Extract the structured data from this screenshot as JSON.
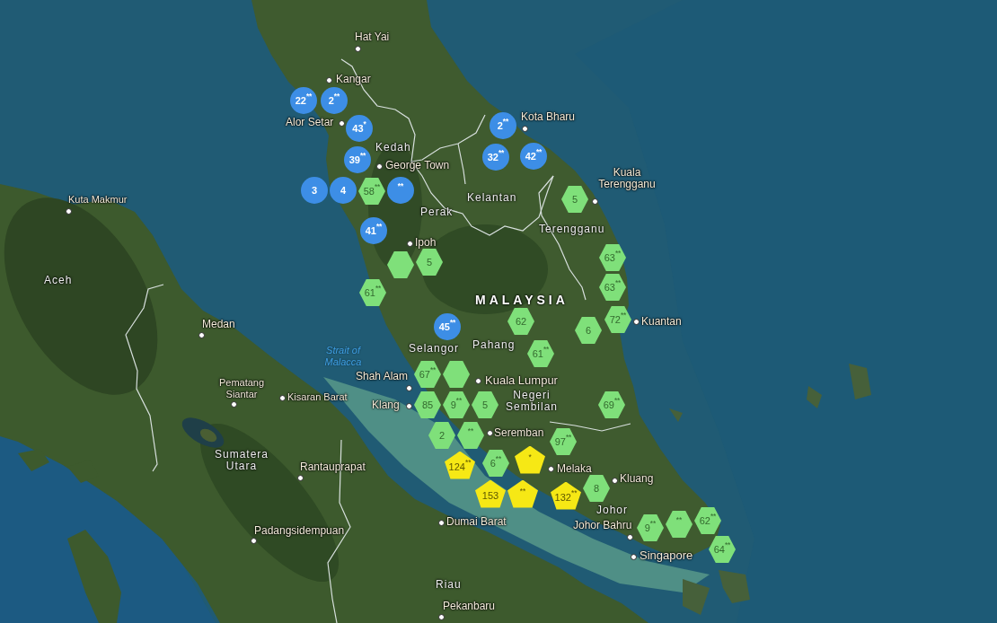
{
  "map": {
    "places": [
      {
        "kind": "city",
        "label": "Hat Yai"
      },
      {
        "kind": "city",
        "label": "Kangar"
      },
      {
        "kind": "city",
        "label": "Alor Setar"
      },
      {
        "kind": "city",
        "label": "Kota Bharu"
      },
      {
        "kind": "region",
        "label": "Kedah"
      },
      {
        "kind": "city",
        "label": "George Town"
      },
      {
        "kind": "city",
        "label": "Kuala Terengganu"
      },
      {
        "kind": "city",
        "label": "Kuta Makmur"
      },
      {
        "kind": "region",
        "label": "Kelantan"
      },
      {
        "kind": "region",
        "label": "Perak"
      },
      {
        "kind": "region",
        "label": "Terengganu"
      },
      {
        "kind": "city",
        "label": "Ipoh"
      },
      {
        "kind": "region",
        "label": "Aceh"
      },
      {
        "kind": "country",
        "label": "MALAYSIA"
      },
      {
        "kind": "city",
        "label": "Medan"
      },
      {
        "kind": "city",
        "label": "Kuantan"
      },
      {
        "kind": "sea",
        "label": "Strait of Malacca"
      },
      {
        "kind": "region",
        "label": "Selangor"
      },
      {
        "kind": "region",
        "label": "Pahang"
      },
      {
        "kind": "city",
        "label": "Shah Alam"
      },
      {
        "kind": "city",
        "label": "Pematang Siantar"
      },
      {
        "kind": "city",
        "label": "Kuala Lumpur"
      },
      {
        "kind": "city",
        "label": "Kisaran Barat"
      },
      {
        "kind": "city",
        "label": "Klang"
      },
      {
        "kind": "region",
        "label": "Negeri Sembilan"
      },
      {
        "kind": "city",
        "label": "Seremban"
      },
      {
        "kind": "region",
        "label": "Sumatera Utara"
      },
      {
        "kind": "city",
        "label": "Rantauprapat"
      },
      {
        "kind": "city",
        "label": "Melaka"
      },
      {
        "kind": "city",
        "label": "Kluang"
      },
      {
        "kind": "region",
        "label": "Johor"
      },
      {
        "kind": "city",
        "label": "Dumai Barat"
      },
      {
        "kind": "city",
        "label": "Padangsidempuan"
      },
      {
        "kind": "city",
        "label": "Johor Bahru"
      },
      {
        "kind": "city",
        "label": "Singapore"
      },
      {
        "kind": "region",
        "label": "Riau"
      },
      {
        "kind": "city",
        "label": "Pekanbaru"
      }
    ],
    "markers": [
      {
        "kind": "circle",
        "color": "#3d8ee6",
        "label": "22$^{**}$"
      },
      {
        "kind": "circle",
        "color": "#3d8ee6",
        "label": "2$^{**}$"
      },
      {
        "kind": "circle",
        "color": "#3d8ee6",
        "label": "43$^{*}$"
      },
      {
        "kind": "circle",
        "color": "#3d8ee6",
        "label": "2$^{**}$"
      },
      {
        "kind": "circle",
        "color": "#3d8ee6",
        "label": "39$^{**}$"
      },
      {
        "kind": "circle",
        "color": "#3d8ee6",
        "label": "32$^{**}$"
      },
      {
        "kind": "circle",
        "color": "#3d8ee6",
        "label": "42$^{**}$"
      },
      {
        "kind": "circle",
        "color": "#3d8ee6",
        "label": "3"
      },
      {
        "kind": "circle",
        "color": "#3d8ee6",
        "label": "4"
      },
      {
        "kind": "hexagon",
        "color": "#7fe07a",
        "label": "58$^{**}$"
      },
      {
        "kind": "circle",
        "color": "#3d8ee6",
        "label": "$^{**}$"
      },
      {
        "kind": "hexagon",
        "color": "#7fe07a",
        "label": "5"
      },
      {
        "kind": "circle",
        "color": "#3d8ee6",
        "label": "41$^{**}$"
      },
      {
        "kind": "hexagon",
        "color": "#7fe07a"
      },
      {
        "kind": "hexagon",
        "color": "#7fe07a",
        "label": "5"
      },
      {
        "kind": "hexagon",
        "color": "#7fe07a",
        "label": "63$^{**}$"
      },
      {
        "kind": "hexagon",
        "color": "#7fe07a",
        "label": "61$^{**}$"
      },
      {
        "kind": "hexagon",
        "color": "#7fe07a",
        "label": "63$^{**}$"
      },
      {
        "kind": "circle",
        "color": "#3d8ee6",
        "label": "45$^{**}$"
      },
      {
        "kind": "hexagon",
        "color": "#7fe07a",
        "label": "62"
      },
      {
        "kind": "hexagon",
        "color": "#7fe07a",
        "label": "6"
      },
      {
        "kind": "hexagon",
        "color": "#7fe07a",
        "label": "72$^{**}$"
      },
      {
        "kind": "hexagon",
        "color": "#7fe07a",
        "label": "61$^{**}$"
      },
      {
        "kind": "hexagon",
        "color": "#7fe07a",
        "label": "67$^{**}$"
      },
      {
        "kind": "hexagon",
        "color": "#7fe07a"
      },
      {
        "kind": "hexagon",
        "color": "#7fe07a",
        "label": "85"
      },
      {
        "kind": "hexagon",
        "color": "#7fe07a",
        "label": "9$^{**}$"
      },
      {
        "kind": "hexagon",
        "color": "#7fe07a",
        "label": "5"
      },
      {
        "kind": "hexagon",
        "color": "#7fe07a",
        "label": "69$^{**}$"
      },
      {
        "kind": "hexagon",
        "color": "#7fe07a",
        "label": "2"
      },
      {
        "kind": "hexagon",
        "color": "#7fe07a",
        "label": "$^{**}$"
      },
      {
        "kind": "hexagon",
        "color": "#7fe07a",
        "label": "97$^{**}$"
      },
      {
        "kind": "pentagon",
        "color": "#f6e815",
        "label": "124$^{**}$"
      },
      {
        "kind": "hexagon",
        "color": "#7fe07a",
        "label": "6$^{**}$"
      },
      {
        "kind": "pentagon",
        "color": "#f6e815",
        "label": "$^{*}$"
      },
      {
        "kind": "pentagon",
        "color": "#f6e815",
        "label": "153"
      },
      {
        "kind": "pentagon",
        "color": "#f6e815",
        "label": "$^{**}$"
      },
      {
        "kind": "pentagon",
        "color": "#f6e815",
        "label": "132$^{**}$"
      },
      {
        "kind": "hexagon",
        "color": "#7fe07a",
        "label": "8"
      },
      {
        "kind": "hexagon",
        "color": "#7fe07a",
        "label": "9$^{**}$"
      },
      {
        "kind": "hexagon",
        "color": "#7fe07a",
        "label": "$^{**}$"
      },
      {
        "kind": "hexagon",
        "color": "#7fe07a",
        "label": "62$^{**}$"
      },
      {
        "kind": "hexagon",
        "color": "#7fe07a",
        "label": "64$^{**}$"
      }
    ]
  }
}
